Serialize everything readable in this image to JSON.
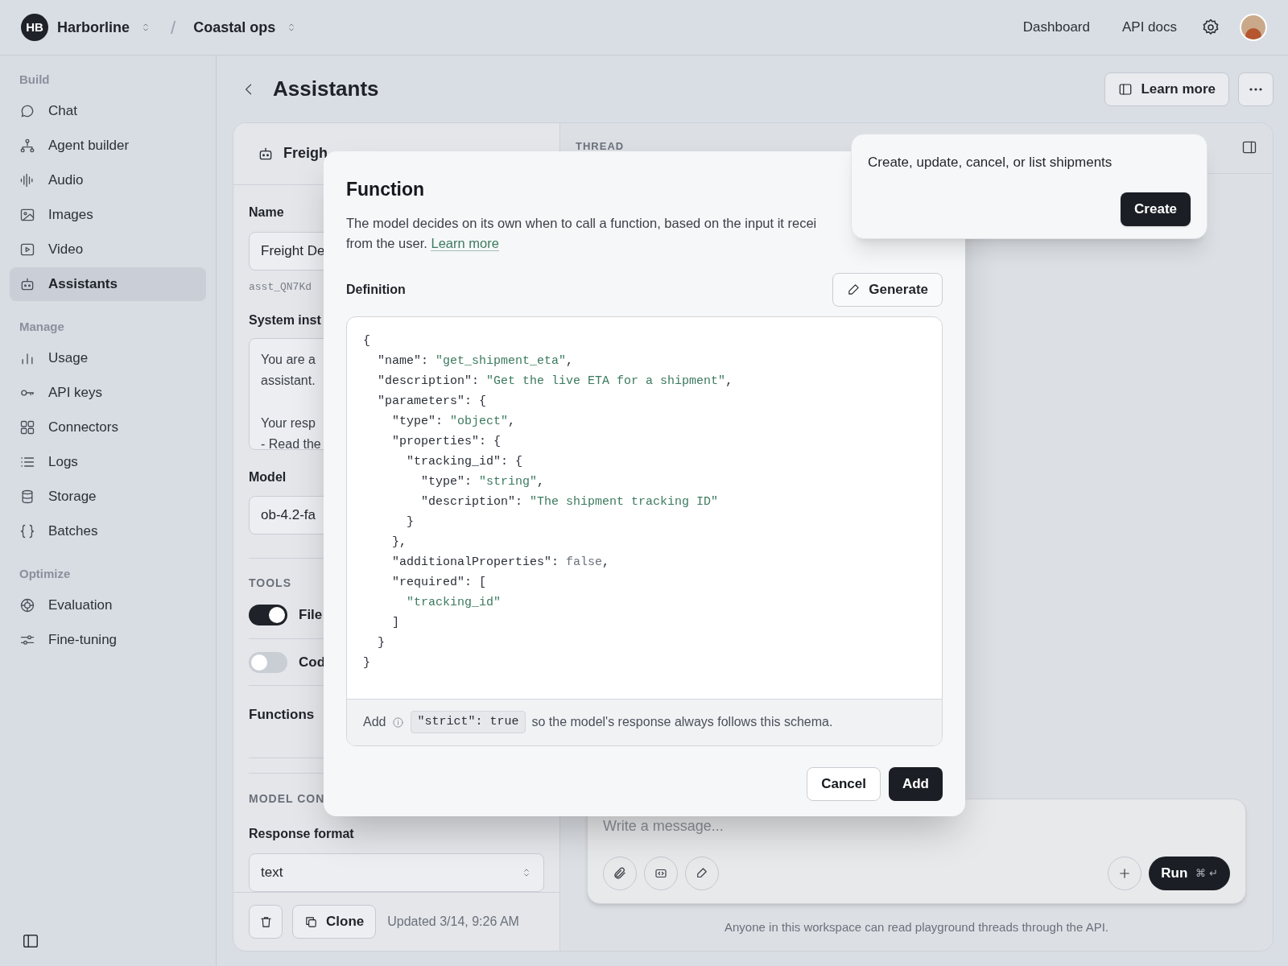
{
  "top_bar": {
    "org": {
      "initials": "HB",
      "name": "Harborline"
    },
    "separator": "/",
    "project": "Coastal ops",
    "links": [
      {
        "label": "Dashboard"
      },
      {
        "label": "API docs"
      }
    ]
  },
  "sidebar": {
    "sections": [
      {
        "title": "Build",
        "items": [
          {
            "label": "Chat",
            "selected": false
          },
          {
            "label": "Agent builder",
            "selected": false
          },
          {
            "label": "Audio",
            "selected": false
          },
          {
            "label": "Images",
            "selected": false
          },
          {
            "label": "Video",
            "selected": false
          },
          {
            "label": "Assistants",
            "selected": true
          }
        ]
      },
      {
        "title": "Manage",
        "items": [
          {
            "label": "Usage",
            "selected": false
          },
          {
            "label": "API keys",
            "selected": false
          },
          {
            "label": "Connectors",
            "selected": false
          },
          {
            "label": "Logs",
            "selected": false
          },
          {
            "label": "Storage",
            "selected": false
          },
          {
            "label": "Batches",
            "selected": false
          }
        ]
      },
      {
        "title": "Optimize",
        "items": [
          {
            "label": "Evaluation",
            "selected": false
          },
          {
            "label": "Fine-tuning",
            "selected": false
          }
        ]
      }
    ]
  },
  "page_header": {
    "title": "Assistants",
    "learn_more": "Learn more"
  },
  "assistant_panel": {
    "title": "Freigh",
    "name_label": "Name",
    "name_value": "Freight De",
    "assistant_id": "asst_QN7Kd",
    "instructions_label": "System inst",
    "instructions": [
      [
        "You are a",
        "assistant."
      ],
      [
        "Your resp",
        "- Read the"
      ]
    ],
    "model_label": "Model",
    "model_value": "ob-4.2-fa",
    "tools_heading": "TOOLS",
    "tools": [
      {
        "label": "File",
        "on": true
      },
      {
        "label": "Cod",
        "on": false
      }
    ],
    "functions_label": "Functions",
    "model_config_heading": "MODEL CON",
    "response_format_label": "Response format",
    "response_format_value": "text",
    "clone": "Clone",
    "updated": "Updated 3/14, 9:26 AM"
  },
  "thread_panel": {
    "heading": "THREAD",
    "placeholder": "Write a message...",
    "run": {
      "label": "Run",
      "shortcut": "⌘ ↵"
    },
    "notice": "Anyone in this workspace can read playground threads through the API."
  },
  "function_dialog": {
    "title": "Function",
    "description_lines": [
      "The model decides on its own when to call a function, based on the input it recei",
      "from the user."
    ],
    "link": "Learn more",
    "definition_label": "Definition",
    "generate": "Generate",
    "code_lines": [
      "{",
      "  \"name\": \"get_shipment_eta\",",
      "  \"description\": \"Get the live ETA for a shipment\",",
      "  \"parameters\": {",
      "    \"type\": \"object\",",
      "    \"properties\": {",
      "      \"tracking_id\": {",
      "        \"type\": \"string\",",
      "        \"description\": \"The shipment tracking ID\"",
      "      }",
      "    },",
      "    \"additionalProperties\": false,",
      "    \"required\": [",
      "      \"tracking_id\"",
      "    ]",
      "  }",
      "}"
    ],
    "strict_hint": {
      "prefix": "Add",
      "code": "\"strict\": true",
      "suffix": "so the model's response always follows this schema."
    },
    "buttons": [
      {
        "label": "Cancel",
        "kind": "secondary"
      },
      {
        "label": "Add",
        "kind": "primary"
      }
    ]
  },
  "popover": {
    "text": "Create, update, cancel, or list shipments",
    "button": "Create"
  }
}
